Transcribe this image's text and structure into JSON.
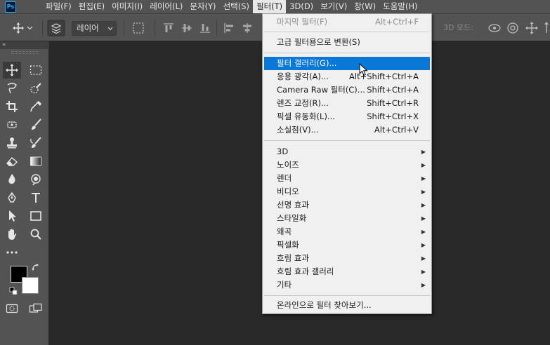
{
  "app": {
    "logo": "Ps"
  },
  "menubar": {
    "items": [
      "파일(F)",
      "편집(E)",
      "이미지(I)",
      "레이어(L)",
      "문자(Y)",
      "선택(S)",
      "필터(T)",
      "3D(D)",
      "보기(V)",
      "창(W)",
      "도움말(H)"
    ],
    "active_index": 6
  },
  "options": {
    "layer_select": "레이어",
    "mode_3d_label": "3D 모드:"
  },
  "toolpanel": {
    "collapse_label": "«"
  },
  "filter_menu": {
    "last_filter": {
      "label": "마지막 필터(F)",
      "shortcut": "Alt+Ctrl+F"
    },
    "convert_smart": {
      "label": "고급 필터용으로 변환(S)"
    },
    "main": [
      {
        "label": "필터 갤러리(G)...",
        "shortcut": ""
      },
      {
        "label": "응용 광각(A)...",
        "shortcut": "Alt+Shift+Ctrl+A"
      },
      {
        "label": "Camera Raw 필터(C)...",
        "shortcut": "Shift+Ctrl+A"
      },
      {
        "label": "렌즈 교정(R)...",
        "shortcut": "Shift+Ctrl+R"
      },
      {
        "label": "픽셀 유동화(L)...",
        "shortcut": "Shift+Ctrl+X"
      },
      {
        "label": "소실점(V)...",
        "shortcut": "Alt+Ctrl+V"
      }
    ],
    "submenus": [
      "3D",
      "노이즈",
      "렌더",
      "비디오",
      "선명 효과",
      "스타일화",
      "왜곡",
      "픽셀화",
      "흐림 효과",
      "흐림 효과 갤러리",
      "기타"
    ],
    "browse_online": "온라인으로 필터 찾아보기..."
  },
  "colors": {
    "accent": "#0a78d7",
    "panel": "#535353",
    "canvas": "#282828",
    "menu_bg": "#f0f0f0"
  }
}
